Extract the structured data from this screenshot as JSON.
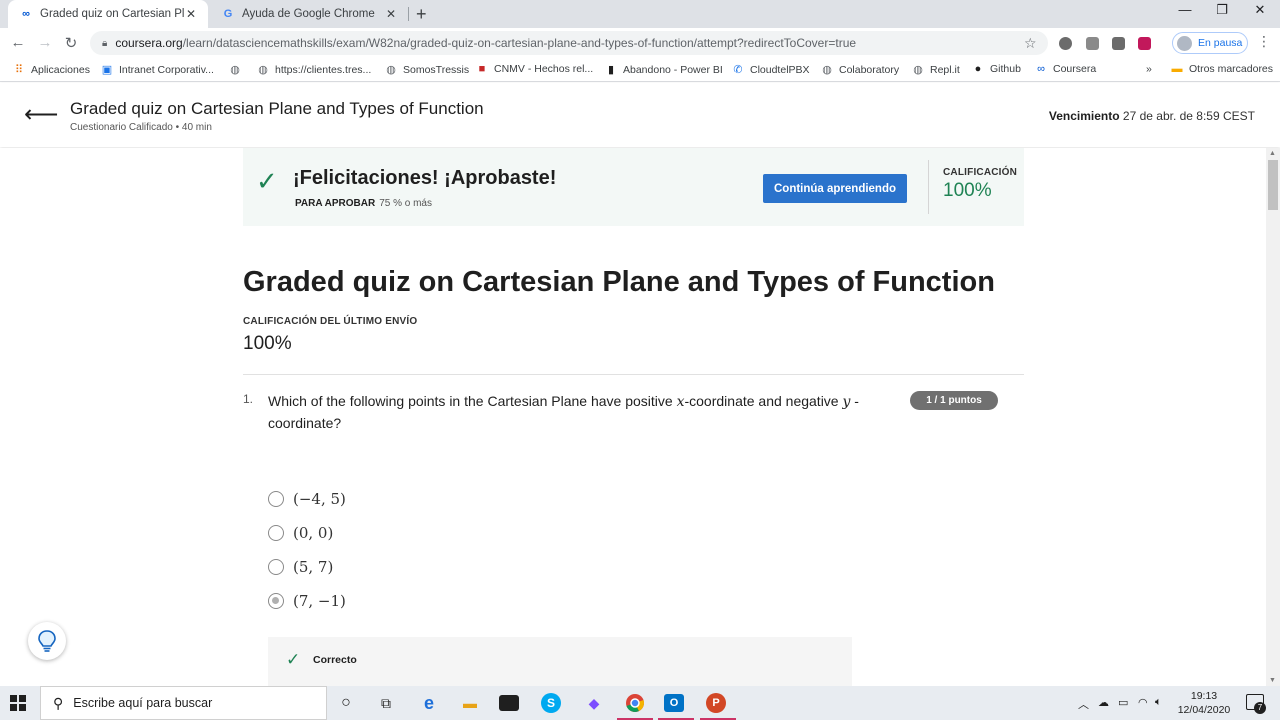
{
  "browser": {
    "tabs": [
      {
        "title": "Graded quiz on Cartesian Plane a",
        "favicon": "coursera-icon",
        "active": true
      },
      {
        "title": "Ayuda de Google Chrome",
        "favicon": "google-icon",
        "active": false
      }
    ],
    "url_host": "coursera.org",
    "url_path": "/learn/datasciencemathskills/exam/W82na/graded-quiz-on-cartesian-plane-and-types-of-function/attempt?redirectToCover=true",
    "profile_label": "En pausa",
    "bookmarks": [
      {
        "label": "Aplicaciones",
        "icon": "apps-grid-icon"
      },
      {
        "label": "Intranet Corporativ...",
        "icon": "intranet-icon"
      },
      {
        "label": "",
        "icon": "globe-icon"
      },
      {
        "label": "https://clientes.tres...",
        "icon": "globe-icon"
      },
      {
        "label": "SomosTressis",
        "icon": "globe-icon"
      },
      {
        "label": "CNMV - Hechos rel...",
        "icon": "cnmv-icon"
      },
      {
        "label": "Abandono - Power BI",
        "icon": "powerbi-icon"
      },
      {
        "label": "CloudtelPBX",
        "icon": "phone-icon"
      },
      {
        "label": "Colaboratory",
        "icon": "globe-icon"
      },
      {
        "label": "Repl.it",
        "icon": "globe-icon"
      },
      {
        "label": "Github",
        "icon": "github-icon"
      },
      {
        "label": "Coursera",
        "icon": "coursera-icon"
      }
    ],
    "bookmarks_overflow": "»",
    "other_bookmarks": "Otros marcadores"
  },
  "header": {
    "title": "Graded quiz on Cartesian Plane and Types of Function",
    "subtitle": "Cuestionario Calificado • 40 min",
    "due_label": "Vencimiento",
    "due_value": "27 de abr. de 8:59 CEST"
  },
  "banner": {
    "title": "¡Felicitaciones! ¡Aprobaste!",
    "pass_label": "PARA APROBAR",
    "pass_value": "75 % o más",
    "button": "Continúa aprendiendo",
    "grade_label": "CALIFICACIÓN",
    "grade_value": "100%",
    "accent_color": "#1f8354",
    "button_color": "#2a73cc"
  },
  "quiz": {
    "title": "Graded quiz on Cartesian Plane and Types of Function",
    "last_label": "CALIFICACIÓN DEL ÚLTIMO ENVÍO",
    "last_value": "100%",
    "question": {
      "number": "1.",
      "text_before_x": "Which of the following points in the Cartesian Plane have positive ",
      "x_var": "x",
      "text_middle": "-coordinate and negative ",
      "y_var": "y",
      "text_after": "-coordinate?",
      "points": "1 / 1 puntos",
      "options": [
        "(−4, 5)",
        "(0, 0)",
        "(5, 7)",
        "(7, −1)"
      ],
      "selected_index": 3,
      "feedback": "Correcto"
    }
  },
  "taskbar": {
    "search_placeholder": "Escribe aquí para buscar",
    "time": "19:13",
    "date": "12/04/2020",
    "notifications": "7"
  }
}
